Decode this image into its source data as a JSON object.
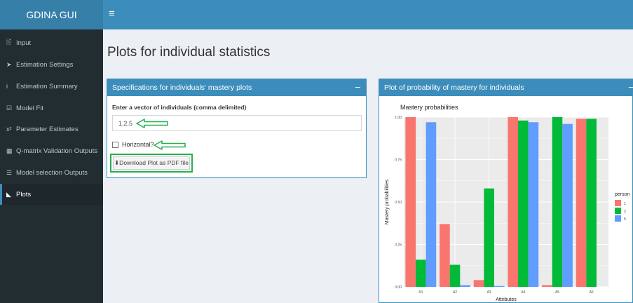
{
  "app": {
    "title": "GDINA GUI",
    "menu_icon": "hamburger-icon"
  },
  "sidebar": {
    "items": [
      {
        "label": "Input",
        "icon": "file-icon",
        "glyph": "🖹"
      },
      {
        "label": "Estimation Settings",
        "icon": "paper-plane-icon",
        "glyph": "➤"
      },
      {
        "label": "Estimation Summary",
        "icon": "info-icon",
        "glyph": "i"
      },
      {
        "label": "Model Fit",
        "icon": "check-square-icon",
        "glyph": "☑"
      },
      {
        "label": "Parameter Estimates",
        "icon": "superscript-icon",
        "glyph": "x²"
      },
      {
        "label": "Q-matrix Validation Outputs",
        "icon": "grid-icon",
        "glyph": "▦"
      },
      {
        "label": "Model selection Outputs",
        "icon": "list-icon",
        "glyph": "☰"
      },
      {
        "label": "Plots",
        "icon": "area-chart-icon",
        "glyph": "◣",
        "active": true
      }
    ]
  },
  "page": {
    "title": "Plots for individual statistics"
  },
  "spec_box": {
    "title": "Specifications for individuals' mastery plots",
    "collapse_symbol": "–",
    "field_label": "Enter a vector of individuals (comma delimited)",
    "field_value": "1,2,5",
    "checkbox_label": "Horizontal?",
    "download_label": "⬇Download Plot as PDF file"
  },
  "plot_box": {
    "title": "Plot of probability of mastery for individuals",
    "collapse_symbol": "–"
  },
  "colors": {
    "p1": "#f8766d",
    "p2": "#00ba38",
    "p5": "#619cff",
    "arrow": "#22b14c"
  },
  "chart_data": {
    "type": "bar",
    "title": "Mastery probabilities",
    "xlabel": "Attributes",
    "ylabel": "Mastery probabilities",
    "categories": [
      "A1",
      "A2",
      "A3",
      "A4",
      "A5",
      "A6"
    ],
    "ylim": [
      0,
      1
    ],
    "yticks": [
      "0.00",
      "0.25",
      "0.50",
      "0.75",
      "1.00"
    ],
    "legend_title": "person",
    "legend_position": "right",
    "series": [
      {
        "name": "1",
        "values": [
          1.0,
          0.37,
          0.04,
          1.0,
          0.01,
          0.99
        ]
      },
      {
        "name": "2",
        "values": [
          0.16,
          0.13,
          0.58,
          0.98,
          1.0,
          0.99
        ]
      },
      {
        "name": "5",
        "values": [
          0.97,
          0.01,
          0.005,
          0.97,
          0.96,
          0.0
        ]
      }
    ]
  }
}
